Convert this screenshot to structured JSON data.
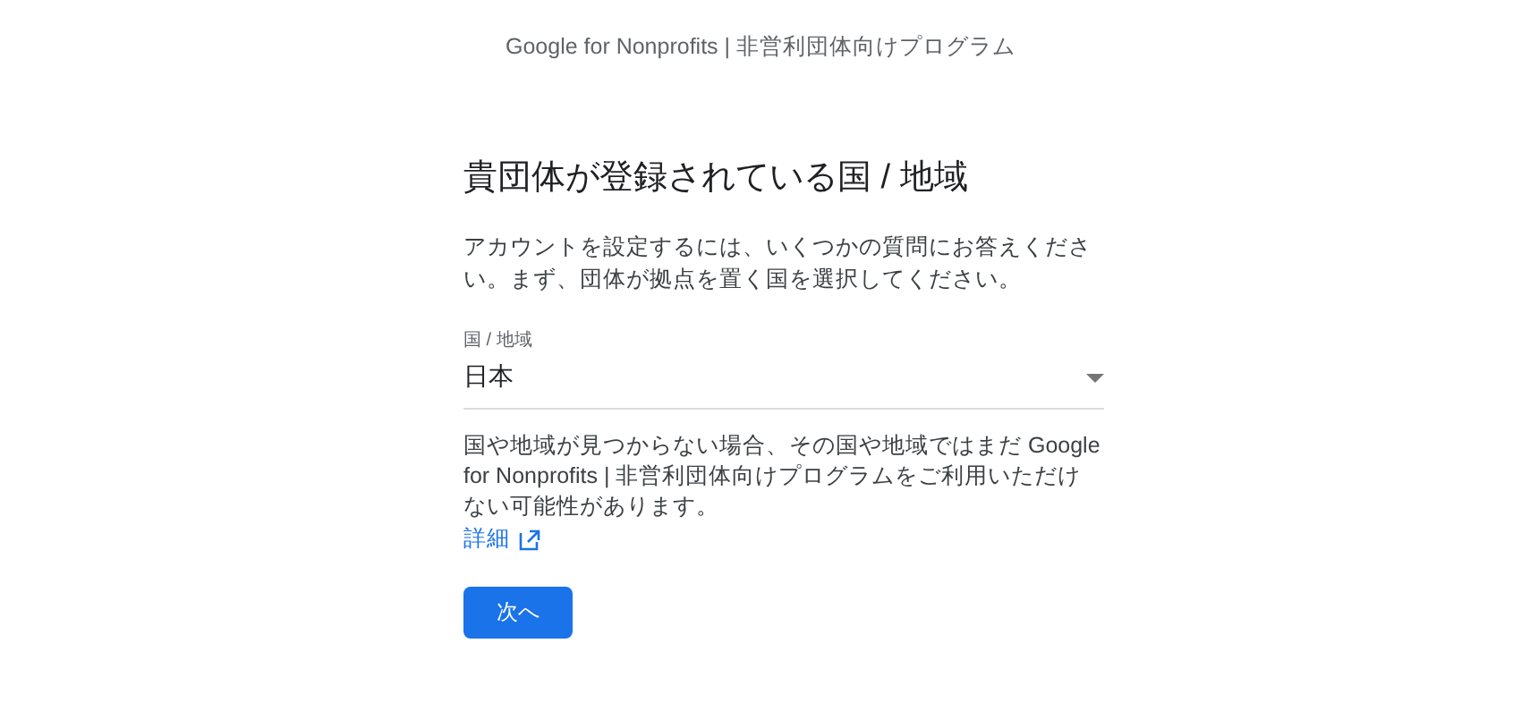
{
  "header": {
    "title": "Google for Nonprofits | 非営利団体向けプログラム"
  },
  "form": {
    "heading": "貴団体が登録されている国 / 地域",
    "intro": "アカウントを設定するには、いくつかの質問にお答えください。まず、団体が拠点を置く国を選択してください。",
    "country_field": {
      "label": "国 / 地域",
      "value": "日本"
    },
    "note": "国や地域が見つからない場合、その国や地域ではまだ Google for Nonprofits | 非営利団体向けプログラムをご利用いただけない可能性があります。",
    "details_link": "詳細",
    "next_button": "次へ"
  }
}
